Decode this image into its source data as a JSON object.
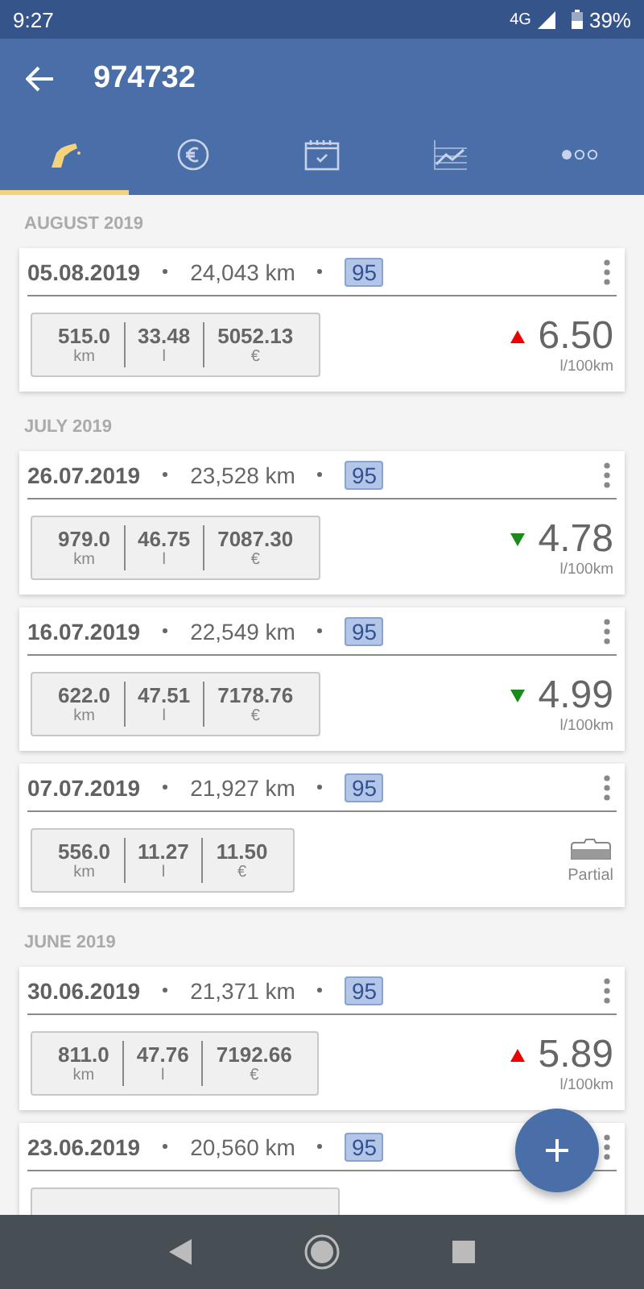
{
  "status_bar": {
    "time": "9:27",
    "network": "4G",
    "battery": "39%"
  },
  "app_bar": {
    "title": "974732"
  },
  "tabs": [
    {
      "kind": "fuel",
      "selected": true
    },
    {
      "kind": "costs",
      "selected": false
    },
    {
      "kind": "calendar",
      "selected": false
    },
    {
      "kind": "chart",
      "selected": false
    },
    {
      "kind": "more",
      "selected": false
    }
  ],
  "sections": [
    {
      "month": "AUGUST 2019",
      "entries": [
        {
          "kind": "consumption",
          "date": "05.08.2019",
          "odometer": "24,043 km",
          "fuel": "95",
          "stats": [
            {
              "value": "515.0",
              "unit": "km"
            },
            {
              "value": "33.48",
              "unit": "l"
            },
            {
              "value": "5052.13",
              "unit": "€"
            }
          ],
          "increase": true,
          "consumption": "6.50",
          "consumption_unit": "l/100km"
        }
      ]
    },
    {
      "month": "JULY 2019",
      "entries": [
        {
          "kind": "consumption",
          "date": "26.07.2019",
          "odometer": "23,528 km",
          "fuel": "95",
          "stats": [
            {
              "value": "979.0",
              "unit": "km"
            },
            {
              "value": "46.75",
              "unit": "l"
            },
            {
              "value": "7087.30",
              "unit": "€"
            }
          ],
          "increase": false,
          "consumption": "4.78",
          "consumption_unit": "l/100km"
        },
        {
          "kind": "consumption",
          "date": "16.07.2019",
          "odometer": "22,549 km",
          "fuel": "95",
          "stats": [
            {
              "value": "622.0",
              "unit": "km"
            },
            {
              "value": "47.51",
              "unit": "l"
            },
            {
              "value": "7178.76",
              "unit": "€"
            }
          ],
          "increase": false,
          "consumption": "4.99",
          "consumption_unit": "l/100km"
        },
        {
          "kind": "partial",
          "date": "07.07.2019",
          "odometer": "21,927 km",
          "fuel": "95",
          "stats": [
            {
              "value": "556.0",
              "unit": "km"
            },
            {
              "value": "11.27",
              "unit": "l"
            },
            {
              "value": "11.50",
              "unit": "€"
            }
          ],
          "partial_label": "Partial"
        }
      ]
    },
    {
      "month": "JUNE 2019",
      "entries": [
        {
          "kind": "consumption",
          "date": "30.06.2019",
          "odometer": "21,371 km",
          "fuel": "95",
          "stats": [
            {
              "value": "811.0",
              "unit": "km"
            },
            {
              "value": "47.76",
              "unit": "l"
            },
            {
              "value": "7192.66",
              "unit": "€"
            }
          ],
          "increase": true,
          "consumption": "5.89",
          "consumption_unit": "l/100km"
        },
        {
          "kind": "cut",
          "date": "23.06.2019",
          "odometer": "20,560 km",
          "fuel": "95"
        }
      ]
    }
  ]
}
